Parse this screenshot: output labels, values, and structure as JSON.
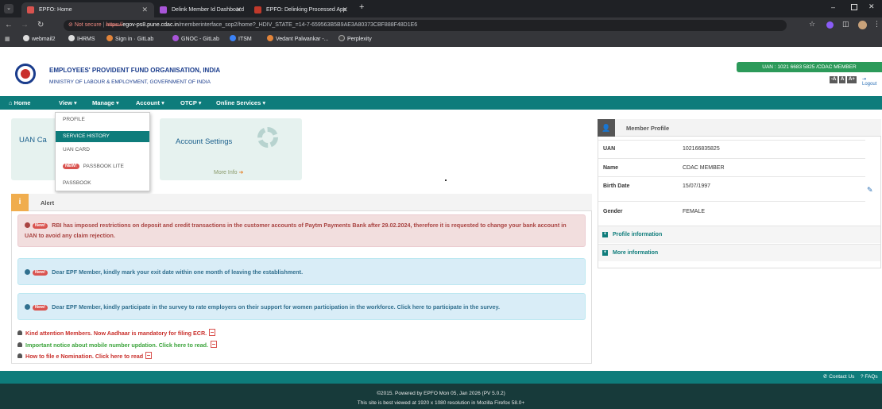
{
  "browser": {
    "tabs": [
      {
        "label": "EPFO: Home",
        "active": true
      },
      {
        "label": "Delink Member Id Dashboard",
        "active": false
      },
      {
        "label": "EPFO: Delinking Processed App",
        "active": false
      }
    ],
    "new_tab": "+",
    "not_secure": "Not secure",
    "url_scheme": "https://",
    "url_host": "egov-ps8.pune.cdac.in",
    "url_path": "/memberinterface_sop2/home?_HDIV_STATE_=14-7-659563B5B9AE3A80373CBF888F48D1E6",
    "bookmarks": [
      "webmail2",
      "IHRMS",
      "Sign in · GitLab",
      "GNOC - GitLab",
      "ITSM",
      "Vedant Palwankar -...",
      "Perplexity"
    ]
  },
  "header": {
    "org_name": "EMPLOYEES' PROVIDENT FUND ORGANISATION, INDIA",
    "ministry": "MINISTRY OF LABOUR & EMPLOYMENT, GOVERNMENT OF INDIA",
    "uan_badge": "UAN : 1021 6683 5825 /CDAC MEMBER",
    "font_buttons": [
      "-A",
      "A",
      "A+"
    ],
    "logout": "Logout"
  },
  "menu": {
    "items": [
      "Home",
      "View",
      "Manage",
      "Account",
      "OTCP",
      "Online Services"
    ]
  },
  "view_dropdown": {
    "items": [
      "PROFILE",
      "SERVICE HISTORY",
      "UAN CARD",
      "PASSBOOK LITE",
      "PASSBOOK"
    ],
    "selected": "SERVICE HISTORY",
    "new_badge": "NEW!"
  },
  "cards": {
    "uan_card": "UAN Ca",
    "account_settings": "Account Settings",
    "more_info": "More Info"
  },
  "alert": {
    "title": "Alert",
    "new_badge": "New!",
    "notices": [
      "RBI has imposed restrictions on deposit and credit transactions in the customer accounts of Paytm Payments Bank after 29.02.2024, therefore it is requested to change your bank account in UAN to avoid any claim rejection.",
      "Dear EPF Member, kindly mark your exit date within one month of leaving the establishment.",
      "Dear EPF Member, kindly participate in the survey to rate employers on their support for women participation in the workforce. Click here to participate in the survey."
    ],
    "links": [
      "Kind attention Members. Now Aadhaar is mandatory for filing ECR.",
      "Important notice about mobile number updation. Click here to read.",
      "How to file e Nomination. Click here to read"
    ],
    "link_colors": [
      "#c9302c",
      "#3aa33a",
      "#c9302c"
    ]
  },
  "profile": {
    "title": "Member Profile",
    "rows": [
      {
        "key": "UAN",
        "value": "102166835825"
      },
      {
        "key": "Name",
        "value": "CDAC MEMBER"
      },
      {
        "key": "Birth Date",
        "value": "15/07/1997"
      },
      {
        "key": "Gender",
        "value": "FEMALE"
      }
    ],
    "sections": [
      "Profile information",
      "More information"
    ]
  },
  "footer": {
    "contact": "Contact Us",
    "faqs": "FAQs",
    "line1": "©2015. Powered by EPFO Mon 05, Jan 2026 (PV 5.0.2)",
    "line2": "This site is best viewed at 1920 x 1080 resolution in Mozilla Firefox 58.0+"
  },
  "colors": {
    "teal": "#0e7c7b",
    "dark_footer": "#173a3a",
    "uan_badge": "#2c9a5a"
  }
}
